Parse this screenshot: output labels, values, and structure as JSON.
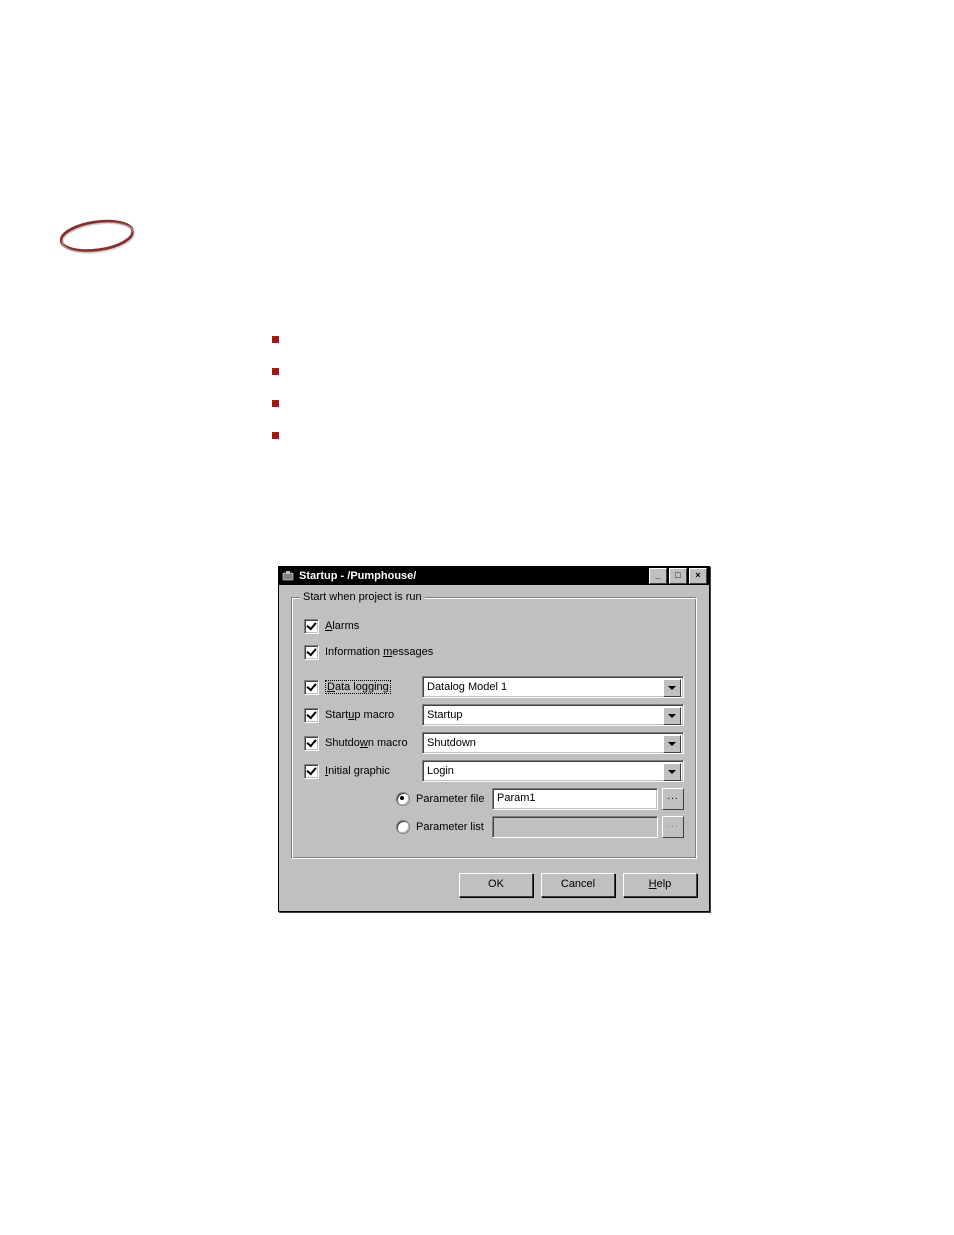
{
  "dialog": {
    "title": "Startup - /Pumphouse/",
    "group_legend": "Start when project is run",
    "checkboxes": {
      "alarms": "Alarms",
      "info_messages": "Information messages",
      "data_logging": "Data logging",
      "startup_macro": "Startup macro",
      "shutdown_macro": "Shutdown macro",
      "initial_graphic": "Initial graphic"
    },
    "dropdown_values": {
      "data_logging": "Datalog Model 1",
      "startup_macro": "Startup",
      "shutdown_macro": "Shutdown",
      "initial_graphic": "Login"
    },
    "parameters": {
      "file_label": "Parameter file",
      "file_value": "Param1",
      "list_label": "Parameter list",
      "list_value": ""
    },
    "buttons": {
      "ok": "OK",
      "cancel": "Cancel",
      "help": "Help"
    },
    "browse": "..."
  }
}
